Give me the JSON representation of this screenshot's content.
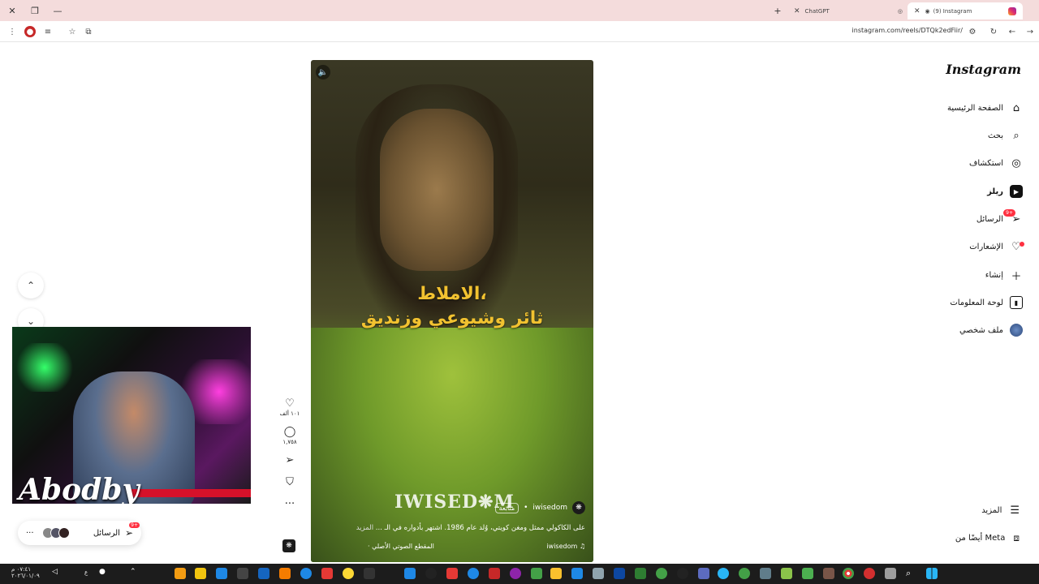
{
  "browser": {
    "tabs": [
      {
        "label": "ChatGPT",
        "active": false
      },
      {
        "label": "(9) Instagram",
        "active": true
      }
    ],
    "url": "instagram.com/reels/DTQk2edFiir/"
  },
  "sidebar": {
    "logo": "Instagram",
    "items": [
      {
        "label": "الصفحة الرئيسية",
        "icon": "home-icon"
      },
      {
        "label": "بحث",
        "icon": "search-icon"
      },
      {
        "label": "استكشاف",
        "icon": "compass-icon"
      },
      {
        "label": "ريلز",
        "icon": "reels-icon"
      },
      {
        "label": "الرسائل",
        "icon": "send-icon",
        "badge": "9+"
      },
      {
        "label": "الإشعارات",
        "icon": "heart-icon"
      },
      {
        "label": "إنشاء",
        "icon": "plus-icon"
      },
      {
        "label": "لوحة المعلومات",
        "icon": "dashboard-icon"
      },
      {
        "label": "ملف شخصي",
        "icon": "profile-avatar-icon"
      }
    ],
    "more_label": "المزيد",
    "meta_label": "أيضًا من Meta"
  },
  "reel": {
    "subtitle_line1": "الاملاط،",
    "subtitle_line2": "ثائر وشيوعي وزنديق",
    "watermark": "IWISED❋M",
    "username": "iwisedom",
    "follow_label": "متابعة",
    "caption": "على الكاكولي ممثل ومغن كويتي، وُلد عام 1986. اشتهر بأدواره في الـ ...",
    "caption_more": "المزيد",
    "audio_user": "iwisedom",
    "audio_label": "المقطع الصوتي الأصلي"
  },
  "actions": {
    "likes": "١٠١ ألف",
    "comments": "١,٧٥٨"
  },
  "messages_pill": {
    "label": "الرسائل",
    "badge": "9+"
  },
  "webcam": {
    "brand": "Abodby"
  },
  "taskbar": {
    "time": "٠٧:٤١ م",
    "date": "٢٠٢٦/٠١/٠٩",
    "lang": "ع"
  },
  "colors": {
    "accent": "#ff3040",
    "subtitle": "#f2c230",
    "tabbar": "#f4dcdc"
  }
}
